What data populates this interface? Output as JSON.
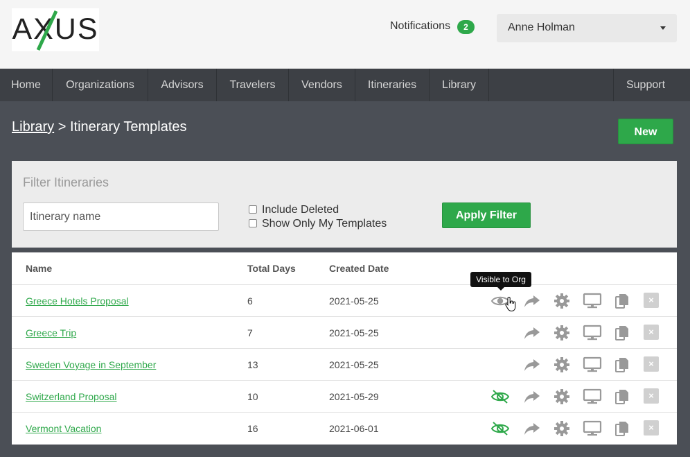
{
  "header": {
    "logo_text": "AXUS",
    "notifications_label": "Notifications",
    "notifications_count": "2",
    "user_name": "Anne Holman"
  },
  "nav": {
    "items": [
      "Home",
      "Organizations",
      "Advisors",
      "Travelers",
      "Vendors",
      "Itineraries",
      "Library"
    ],
    "support": "Support"
  },
  "page": {
    "breadcrumb_link": "Library",
    "breadcrumb_separator": ">",
    "title": "Itinerary Templates",
    "new_button": "New"
  },
  "filter": {
    "title": "Filter Itineraries",
    "name_placeholder": "Itinerary name",
    "include_deleted_label": "Include Deleted",
    "show_only_mine_label": "Show Only My Templates",
    "include_deleted_checked": false,
    "show_only_mine_checked": false,
    "apply_button": "Apply Filter"
  },
  "table": {
    "headers": [
      "Name",
      "Total Days",
      "Created Date"
    ],
    "rows": [
      {
        "name": "Greece Hotels Proposal",
        "days": "6",
        "created": "2021-05-25",
        "visibility": "visible"
      },
      {
        "name": "Greece Trip",
        "days": "7",
        "created": "2021-05-25",
        "visibility": "none"
      },
      {
        "name": "Sweden Voyage in September",
        "days": "13",
        "created": "2021-05-25",
        "visibility": "none"
      },
      {
        "name": "Switzerland Proposal",
        "days": "10",
        "created": "2021-05-29",
        "visibility": "hidden"
      },
      {
        "name": "Vermont Vacation",
        "days": "16",
        "created": "2021-06-01",
        "visibility": "hidden"
      }
    ]
  },
  "tooltip": "Visible to Org",
  "colors": {
    "accent_green": "#2ea84a",
    "nav_bg": "#3d4045",
    "page_bg": "#4b4f56"
  }
}
